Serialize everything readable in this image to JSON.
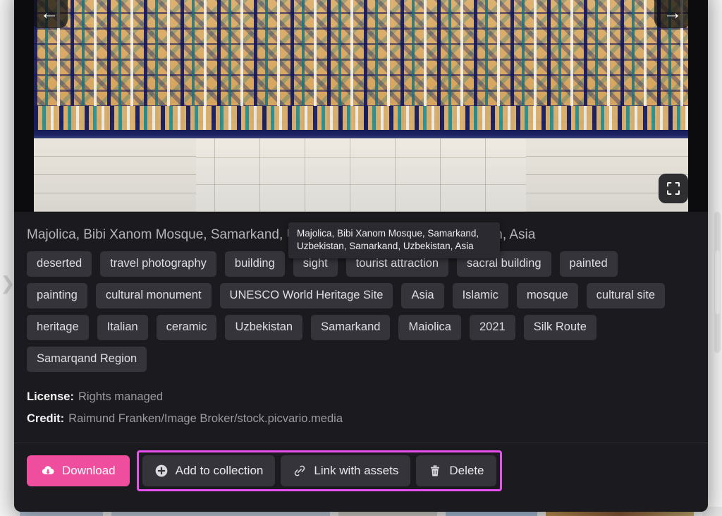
{
  "viewer": {
    "prev_label": "←",
    "next_label": "→",
    "fullscreen_icon": "fullscreen-icon",
    "image_alt": "Majolica tilework, Bibi Xanom Mosque, Samarkand"
  },
  "asset": {
    "title": "Majolica, Bibi Xanom Mosque, Samarkand, Uzbekistan, Samarkand, Uzbekistan, Asia",
    "tooltip": "Majolica, Bibi Xanom Mosque, Samarkand, Uzbekistan, Samarkand, Uzbekistan, Asia",
    "tags": [
      "deserted",
      "travel photography",
      "building",
      "sight",
      "tourist attraction",
      "sacral building",
      "painted",
      "painting",
      "cultural monument",
      "UNESCO World Heritage Site",
      "Asia",
      "Islamic",
      "mosque",
      "cultural site",
      "heritage",
      "Italian",
      "ceramic",
      "Uzbekistan",
      "Samarkand",
      "Maiolica",
      "2021",
      "Silk Route",
      "Samarqand Region"
    ],
    "license_label": "License:",
    "license_value": "Rights managed",
    "credit_label": "Credit:",
    "credit_value": "Raimund Franken/Image Broker/stock.picvario.media"
  },
  "actions": {
    "download": "Download",
    "add_to_collection": "Add to collection",
    "link_with_assets": "Link with assets",
    "delete": "Delete"
  },
  "colors": {
    "accent_pink": "#ef4e9e",
    "highlight_magenta": "#e84ff0",
    "modal_bg": "#1b1b1f",
    "tag_bg": "#34343a"
  },
  "thumbnails": [
    "#b9c8dc",
    "#c2cfe0",
    "#d6d3cc",
    "#adc4de",
    "#c89a55",
    "#e6e6e6",
    "#d8b882"
  ]
}
